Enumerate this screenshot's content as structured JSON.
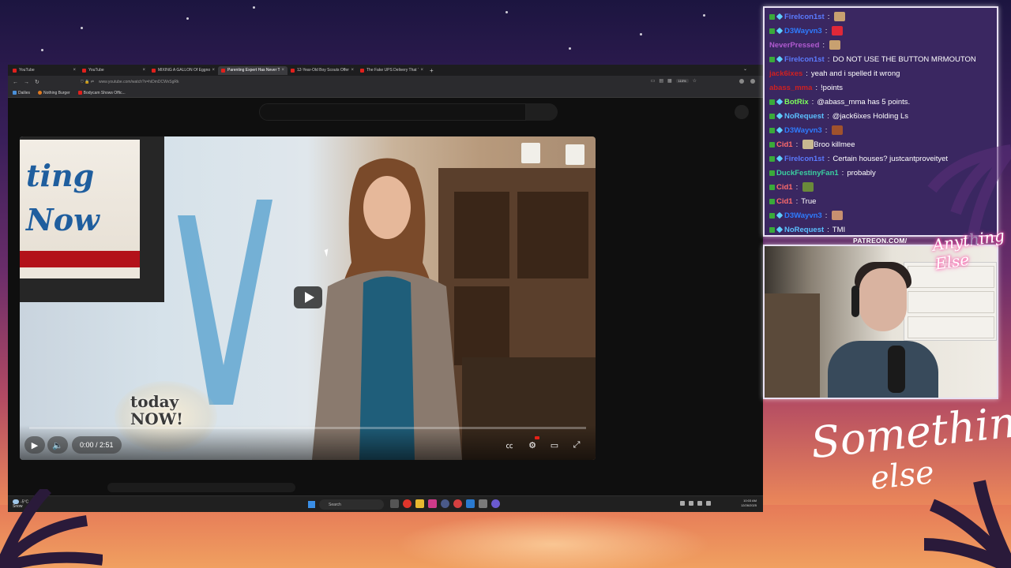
{
  "browser": {
    "tabs": [
      {
        "title": "YouTube",
        "active": false
      },
      {
        "title": "YouTube",
        "active": false
      },
      {
        "title": "MIXING A GALLON Of Eggnog",
        "active": false
      },
      {
        "title": "Parenting Expert Has Never Ta",
        "active": true
      },
      {
        "title": "12-Year-Old Boy Scouts Offer",
        "active": false
      },
      {
        "title": "The Fake UPS Delivery That Tur",
        "active": false
      }
    ],
    "new_tab": "+",
    "url": "www.youtube.com/watch?v=hiDmDCWvSgRk",
    "zoom": "110%",
    "bookmarks": [
      "Dailies",
      "Nothing Burger",
      "Bodycam Shows Offic..."
    ]
  },
  "video": {
    "screen_text": "ting\nNow",
    "logo_text": "today\nNOW!",
    "time": "0:00 / 2:51",
    "progress": 0
  },
  "taskbar": {
    "weather_temp": "-5°C",
    "weather_desc": "Snow",
    "search": "Search",
    "time": "10:03 AM",
    "date": "12/26/2025"
  },
  "chat": [
    {
      "user": "FireIcon1st",
      "text": "",
      "color": "#5b7bff",
      "badges": [
        "mod",
        "sub"
      ],
      "emote": "#c8a070"
    },
    {
      "user": "D3Wayvn3",
      "text": "",
      "color": "#2e7cff",
      "badges": [
        "mod",
        "sub"
      ],
      "emote": "#e02838"
    },
    {
      "user": "NeverPressed",
      "text": "",
      "color": "#b05ad0",
      "badges": [],
      "emote": "#c8a070"
    },
    {
      "user": "FireIcon1st",
      "text": "DO NOT USE THE BUTTON MRMOUTON",
      "color": "#5b7bff",
      "badges": [
        "mod",
        "sub"
      ],
      "emote": ""
    },
    {
      "user": "jack6ixes",
      "text": "yeah and i spelled it wrong",
      "color": "#d02020",
      "badges": [],
      "emote": ""
    },
    {
      "user": "abass_mma",
      "text": "!points",
      "color": "#d02020",
      "badges": [],
      "emote": ""
    },
    {
      "user": "BotRix",
      "text": "@abass_mma has 5 points.",
      "color": "#7cff5a",
      "badges": [
        "mod",
        "sub"
      ],
      "emote": ""
    },
    {
      "user": "NoRequest",
      "text": "@jack6ixes Holding Ls",
      "color": "#5bc0ff",
      "badges": [
        "mod",
        "sub"
      ],
      "emote": ""
    },
    {
      "user": "D3Wayvn3",
      "text": "",
      "color": "#2e7cff",
      "badges": [
        "mod",
        "sub"
      ],
      "emote": "#a0522d"
    },
    {
      "user": "Cid1",
      "text": "Broo killmee",
      "color": "#ff6b6b",
      "badges": [
        "mod"
      ],
      "emote": "#c8b890"
    },
    {
      "user": "FireIcon1st",
      "text": "Certain houses? justcantproveityet",
      "color": "#5b7bff",
      "badges": [
        "mod",
        "sub"
      ],
      "emote": ""
    },
    {
      "user": "DuckFestinyFan1",
      "text": "probably",
      "color": "#3ad0a0",
      "badges": [
        "mod"
      ],
      "emote": ""
    },
    {
      "user": "Cid1",
      "text": "",
      "color": "#ff6b6b",
      "badges": [
        "mod"
      ],
      "emote": "#6a8a3a"
    },
    {
      "user": "Cid1",
      "text": "True",
      "color": "#ff6b6b",
      "badges": [
        "mod"
      ],
      "emote": ""
    },
    {
      "user": "D3Wayvn3",
      "text": "",
      "color": "#2e7cff",
      "badges": [
        "mod",
        "sub"
      ],
      "emote": "#c89070"
    },
    {
      "user": "NoRequest",
      "text": "TMI",
      "color": "#5bc0ff",
      "badges": [
        "mod",
        "sub"
      ],
      "emote": ""
    }
  ],
  "overlay": {
    "patreon": "PATREON.COM/",
    "signature_small": "Anything Else",
    "signature_big_1": "Something",
    "signature_big_2": "else"
  }
}
